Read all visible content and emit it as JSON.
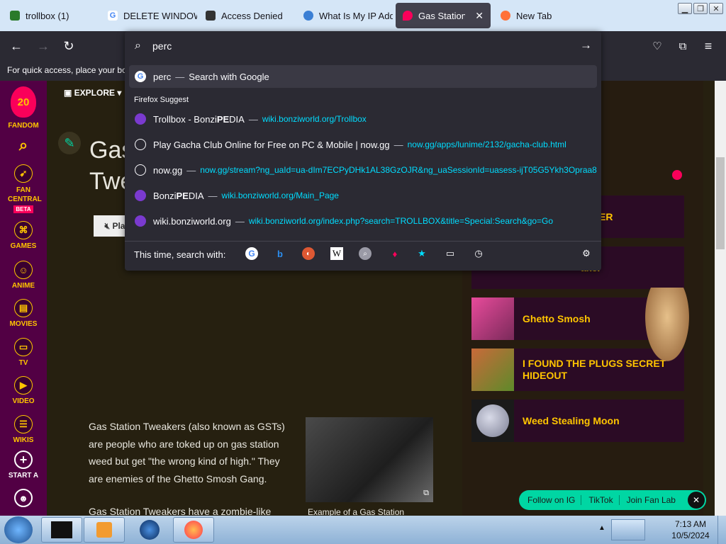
{
  "tabs": [
    {
      "title": "trollbox (1)",
      "icon": "bonzi-icon",
      "color": "#2a7a2a"
    },
    {
      "title": "DELETE WINDOW",
      "icon": "google-icon",
      "color": "#4285f4"
    },
    {
      "title": "Access Denied",
      "icon": "shield-icon",
      "color": "#222222"
    },
    {
      "title": "What Is My IP Add",
      "icon": "globe-icon",
      "color": "#3b7fd4"
    },
    {
      "title": "Gas Station Twe",
      "icon": "fandom-icon",
      "color": "#fa005a",
      "active": true
    },
    {
      "title": "New Tab",
      "icon": "firefox-icon",
      "color": "#ff7139"
    }
  ],
  "urlbar": {
    "value": "perc"
  },
  "bookmarks_hint": "For quick access, place your boo",
  "suggestions": {
    "top": {
      "text": "perc",
      "suffix": "Search with Google"
    },
    "section_label": "Firefox Suggest",
    "items": [
      {
        "title_pre": "Trollbox - Bonzi",
        "title_bold": "PE",
        "title_post": "DIA",
        "url": "wiki.bonziworld.org/Trollbox",
        "icon": "bonzi-icon"
      },
      {
        "title_pre": "Play Gacha Club Online for Free on PC & Mobile | now.gg",
        "title_bold": "",
        "title_post": "",
        "url": "now.gg/apps/lunime/2132/gacha-club.html",
        "icon": "globe-icon"
      },
      {
        "title_pre": "now.gg",
        "title_bold": "",
        "title_post": "",
        "url": "now.gg/stream?ng_uaId=ua-dIm7ECPyDHk1AL38GzOJR&ng_uaSessionId=uasess-ijT05G5Ykh3Opraa8",
        "icon": "globe-icon"
      },
      {
        "title_pre": "Bonzi",
        "title_bold": "PE",
        "title_post": "DIA",
        "url": "wiki.bonziworld.org/Main_Page",
        "icon": "bonzi-icon"
      },
      {
        "title_pre": "wiki.bonziworld.org",
        "title_bold": "",
        "title_post": "",
        "url": "wiki.bonziworld.org/index.php?search=TROLLBOX&title=Special:Search&go=Go",
        "icon": "bonzi-icon"
      }
    ],
    "search_with_label": "This time, search with:"
  },
  "rail": [
    {
      "label": "FANDOM",
      "icon": "fandom-logo-icon"
    },
    {
      "label": "",
      "icon": "search-icon"
    },
    {
      "label": "FAN CENTRAL",
      "icon": "rocket-icon",
      "badge": "BETA"
    },
    {
      "label": "GAMES",
      "icon": "gamepad-icon"
    },
    {
      "label": "ANIME",
      "icon": "anime-icon"
    },
    {
      "label": "MOVIES",
      "icon": "movie-icon"
    },
    {
      "label": "TV",
      "icon": "tv-icon"
    },
    {
      "label": "VIDEO",
      "icon": "video-icon"
    },
    {
      "label": "WIKIS",
      "icon": "book-icon"
    },
    {
      "label": "START A",
      "icon": "plus-icon"
    }
  ],
  "fandom_badge": "20",
  "article": {
    "explore": "EXPLORE",
    "title_line1": "Gas",
    "title_line2": "Twe",
    "body1": "Gas Station Tweakers (also known as GSTs) are people who are toked up on gas station weed but get \"the wrong kind of high.\" They are enemies of the Ghetto Smosh Gang.",
    "body2": "Gas Station Tweakers have a zombie-like",
    "caption": "Example of a Gas Station",
    "play": "Pla"
  },
  "sidebar_cards": [
    {
      "title": "ER"
    },
    {
      "title": "aker"
    },
    {
      "title": "Ghetto Smosh"
    },
    {
      "title": "I FOUND THE PLUGS SECRET HIDEOUT"
    },
    {
      "title": "Weed Stealing Moon"
    }
  ],
  "followbar": {
    "ig": "Follow on IG",
    "tiktok": "TikTok",
    "fanlab": "Join Fan Lab"
  },
  "clock": {
    "time": "7:13 AM",
    "date": "10/5/2024"
  },
  "colors": {
    "fandom_pink": "#fa005a",
    "fandom_yellow": "#ffc500",
    "link_cyan": "#00ddff",
    "follow_green": "#00d6a3"
  }
}
